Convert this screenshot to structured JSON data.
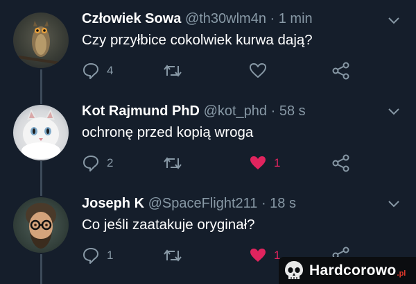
{
  "tweets": [
    {
      "name": "Człowiek Sowa",
      "handle": "@th30wlm4n",
      "time": "· 1 min",
      "text": "Czy przyłbice cokolwiek kurwa dają?",
      "replies": "4",
      "retweets": "",
      "likes": "",
      "liked": false,
      "avatar": "owl-avatar"
    },
    {
      "name": "Kot Rajmund PhD",
      "handle": "@kot_phd",
      "time": "· 58 s",
      "text": "ochronę przed kopią wroga",
      "replies": "2",
      "retweets": "",
      "likes": "1",
      "liked": true,
      "avatar": "cat-avatar"
    },
    {
      "name": "Joseph K",
      "handle": "@SpaceFlight211",
      "time": "· 18 s",
      "text": "Co jeśli zaatakuje oryginał?",
      "replies": "1",
      "retweets": "",
      "likes": "1",
      "liked": true,
      "avatar": "man-avatar"
    }
  ],
  "watermark": {
    "text": "Hardcorowo",
    "suffix": ".pl"
  },
  "colors": {
    "background": "#151e2b",
    "secondary_text": "#8899a6",
    "like": "#e0245e",
    "thread_line": "#3c4a59"
  }
}
